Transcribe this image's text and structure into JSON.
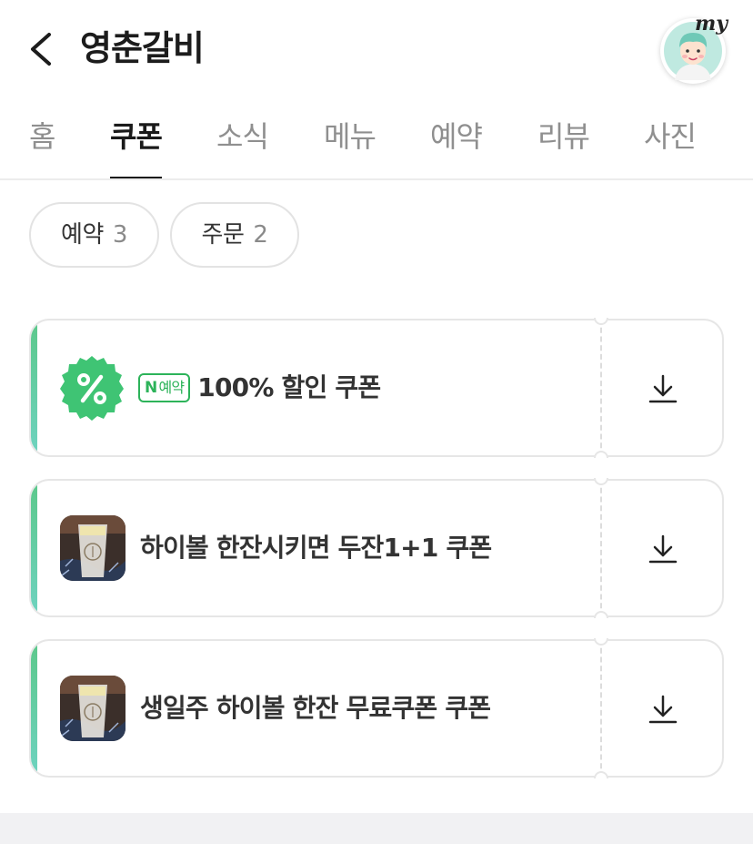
{
  "header": {
    "title": "영춘갈비",
    "my_label": "my"
  },
  "tabs": [
    {
      "label": "홈"
    },
    {
      "label": "쿠폰"
    },
    {
      "label": "소식"
    },
    {
      "label": "메뉴"
    },
    {
      "label": "예약"
    },
    {
      "label": "리뷰"
    },
    {
      "label": "사진"
    }
  ],
  "active_tab": "쿠폰",
  "filters": [
    {
      "label": "예약",
      "count": "3"
    },
    {
      "label": "주문",
      "count": "2"
    }
  ],
  "coupons": [
    {
      "badge_letter": "N",
      "badge_text": "예약",
      "title": "100% 할인 쿠폰",
      "icon": "percent-badge-icon"
    },
    {
      "title": "하이볼 한잔시키면 두잔1+1 쿠폰",
      "icon": "highball-photo"
    },
    {
      "title": "생일주 하이볼 한잔 무료쿠폰 쿠폰",
      "icon": "highball-photo"
    }
  ],
  "colors": {
    "accent_green": "#2db35a",
    "stripe_top": "#5cc88a",
    "stripe_bottom": "#6fd3c2",
    "percent_badge": "#3fc474"
  }
}
